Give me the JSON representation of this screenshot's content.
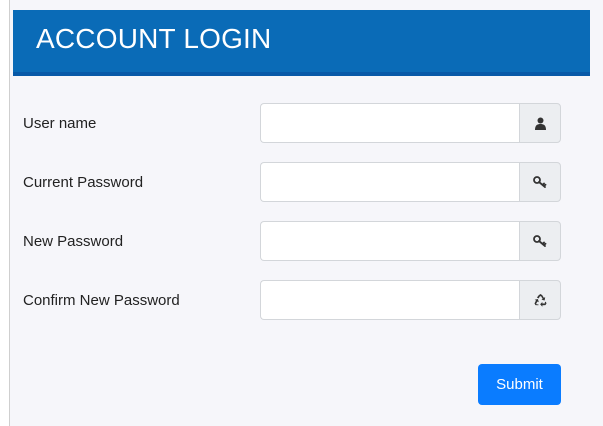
{
  "header": {
    "title": "ACCOUNT LOGIN"
  },
  "form": {
    "fields": [
      {
        "label": "User name",
        "value": "",
        "placeholder": "",
        "icon": "user-icon"
      },
      {
        "label": "Current Password",
        "value": "",
        "placeholder": "",
        "icon": "key-icon"
      },
      {
        "label": "New Password",
        "value": "",
        "placeholder": "",
        "icon": "key-icon"
      },
      {
        "label": "Confirm New Password",
        "value": "",
        "placeholder": "",
        "icon": "recycle-icon"
      }
    ],
    "submit_label": "Submit"
  },
  "colors": {
    "header_bg": "#0a6bb7",
    "header_border": "#0859a8",
    "panel_bg": "#f6f6fa",
    "button_bg": "#0a7cff",
    "addon_bg": "#eceef1"
  }
}
